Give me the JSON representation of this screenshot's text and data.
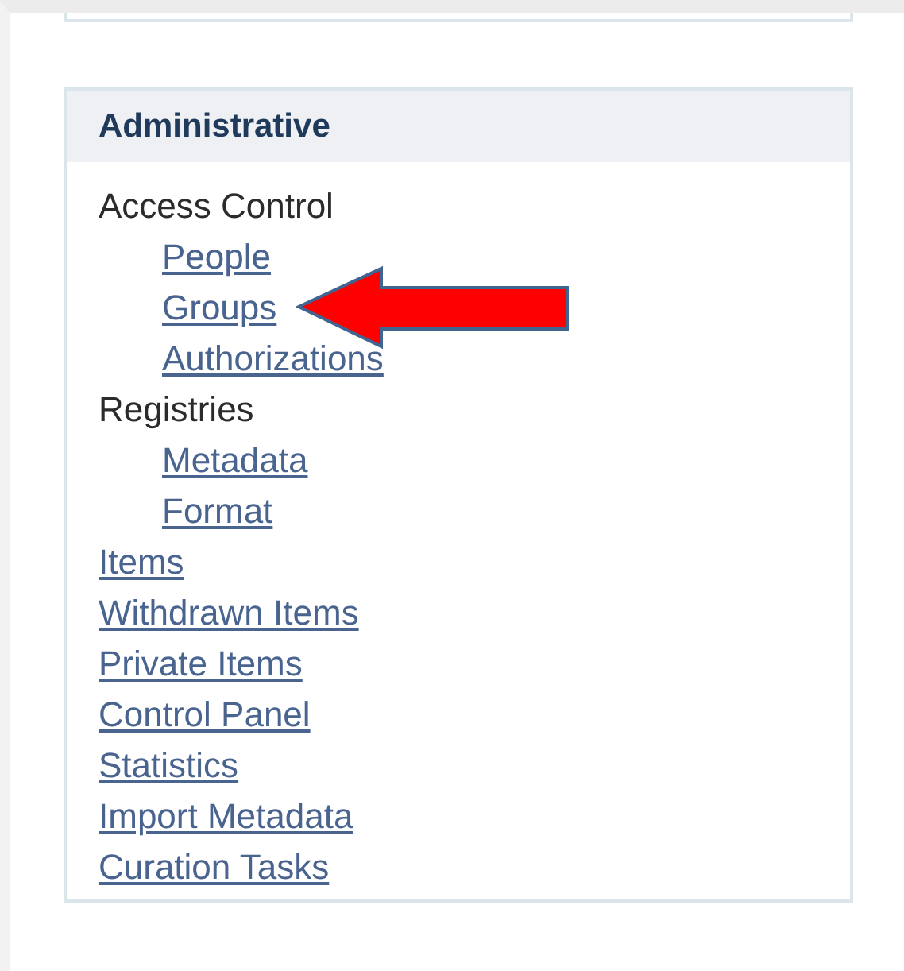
{
  "panel": {
    "title": "Administrative",
    "items": [
      {
        "kind": "heading",
        "label": "Access Control",
        "children": [
          {
            "kind": "link",
            "label": "People"
          },
          {
            "kind": "link",
            "label": "Groups"
          },
          {
            "kind": "link",
            "label": "Authorizations"
          }
        ]
      },
      {
        "kind": "heading",
        "label": "Registries",
        "children": [
          {
            "kind": "link",
            "label": "Metadata"
          },
          {
            "kind": "link",
            "label": "Format"
          }
        ]
      },
      {
        "kind": "link",
        "label": "Items"
      },
      {
        "kind": "link",
        "label": "Withdrawn Items"
      },
      {
        "kind": "link",
        "label": "Private Items"
      },
      {
        "kind": "link",
        "label": "Control Panel"
      },
      {
        "kind": "link",
        "label": "Statistics"
      },
      {
        "kind": "link",
        "label": "Import Metadata"
      },
      {
        "kind": "link",
        "label": "Curation Tasks"
      }
    ]
  }
}
